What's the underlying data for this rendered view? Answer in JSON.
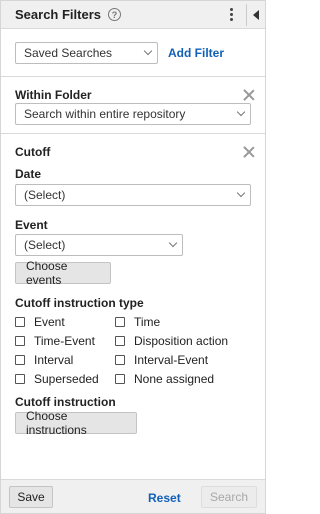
{
  "header": {
    "title": "Search Filters",
    "help_glyph": "?"
  },
  "saved_searches": {
    "selected": "Saved Searches",
    "add_filter_label": "Add Filter"
  },
  "within_folder": {
    "title": "Within Folder",
    "selected": "Search within entire repository"
  },
  "cutoff": {
    "title": "Cutoff",
    "date_label": "Date",
    "date_selected": "(Select)",
    "event_label": "Event",
    "event_selected": "(Select)",
    "choose_events_label": "Choose events",
    "instruction_type_label": "Cutoff instruction type",
    "instruction_types": [
      {
        "label": "Event",
        "checked": false
      },
      {
        "label": "Time",
        "checked": false
      },
      {
        "label": "Time-Event",
        "checked": false
      },
      {
        "label": "Disposition action",
        "checked": false
      },
      {
        "label": "Interval",
        "checked": false
      },
      {
        "label": "Interval-Event",
        "checked": false
      },
      {
        "label": "Superseded",
        "checked": false
      },
      {
        "label": "None assigned",
        "checked": false
      }
    ],
    "instruction_label": "Cutoff instruction",
    "choose_instructions_label": "Choose instructions"
  },
  "footer": {
    "save_label": "Save",
    "reset_label": "Reset",
    "search_label": "Search"
  },
  "colors": {
    "link": "#1160b7",
    "header_bg": "#f0f0f0"
  }
}
